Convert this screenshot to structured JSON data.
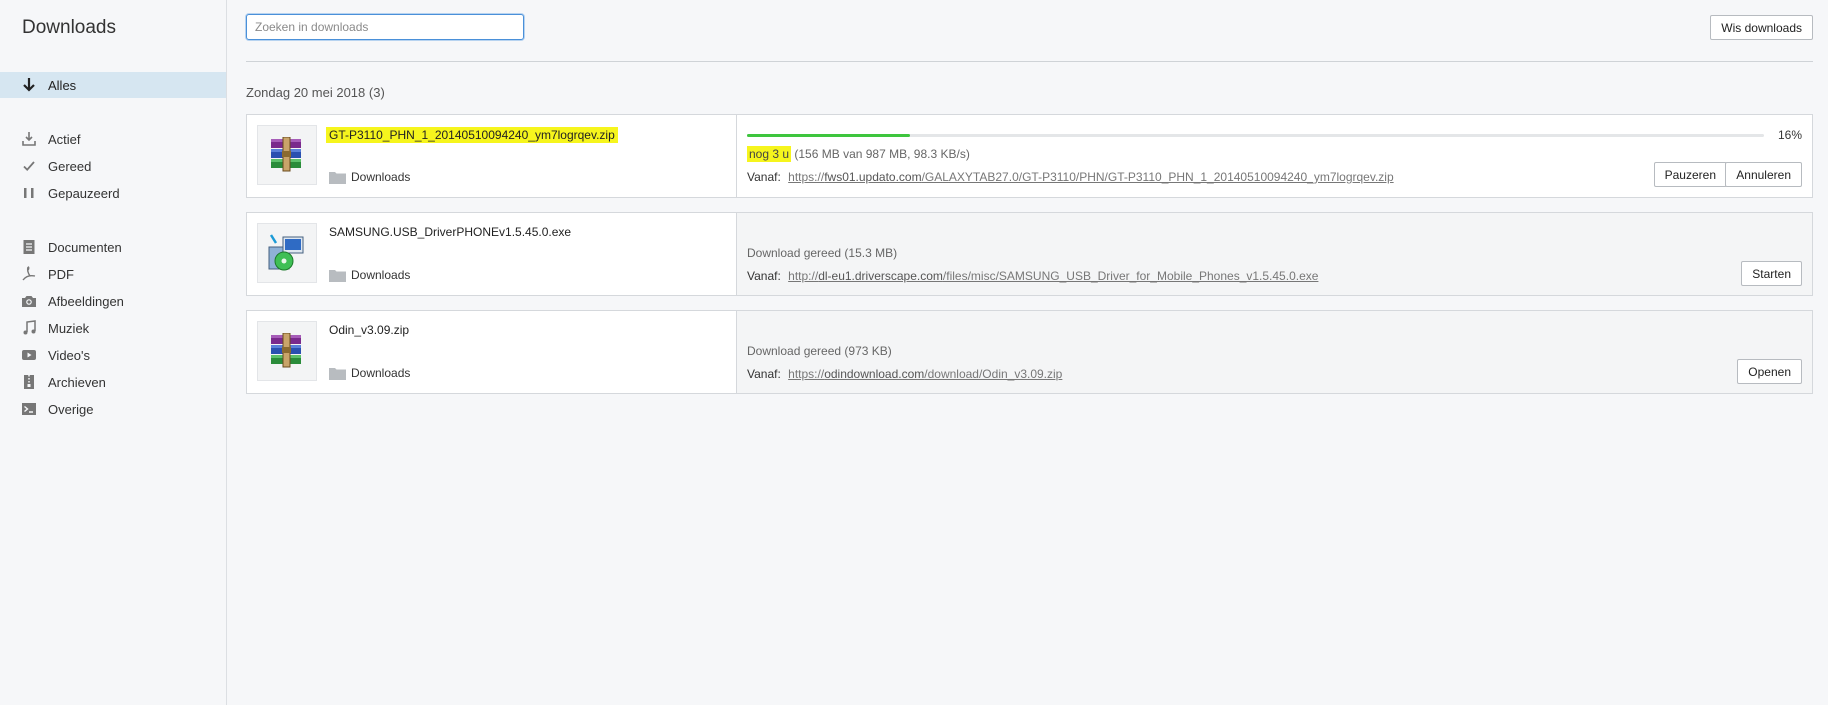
{
  "sidebar": {
    "title": "Downloads",
    "items": [
      {
        "label": "Alles",
        "icon": "arrow-down-icon"
      },
      {
        "label": "Actief",
        "icon": "download-tray-icon"
      },
      {
        "label": "Gereed",
        "icon": "checkmark-icon"
      },
      {
        "label": "Gepauzeerd",
        "icon": "pause-icon"
      },
      {
        "label": "Documenten",
        "icon": "document-icon"
      },
      {
        "label": "PDF",
        "icon": "pdf-icon"
      },
      {
        "label": "Afbeeldingen",
        "icon": "camera-icon"
      },
      {
        "label": "Muziek",
        "icon": "music-note-icon"
      },
      {
        "label": "Video's",
        "icon": "video-icon"
      },
      {
        "label": "Archieven",
        "icon": "archive-icon"
      },
      {
        "label": "Overige",
        "icon": "terminal-icon"
      }
    ]
  },
  "search": {
    "placeholder": "Zoeken in downloads",
    "value": ""
  },
  "toolbar": {
    "clear_label": "Wis downloads"
  },
  "group": {
    "date": "Zondag 20 mei 2018",
    "count": "(3)"
  },
  "downloads": [
    {
      "filename": "GT-P3110_PHN_1_20140510094240_ym7logrqev.zip",
      "folder": "Downloads",
      "progress_label": "16%",
      "progress_value": 0.16,
      "remaining": "nog 3 u",
      "status_detail": "(156 MB van 987 MB, 98.3 KB/s)",
      "source_label": "Vanaf:",
      "url_scheme": "https://",
      "url_host": "fws01.updato.com",
      "url_path": "/GALAXYTAB27.0/GT-P3110/PHN/GT-P3110_PHN_1_20140510094240_ym7logrqev.zip",
      "buttons": [
        "Pauzeren",
        "Annuleren"
      ],
      "icon": "winrar-archive-icon"
    },
    {
      "filename": "SAMSUNG.USB_DriverPHONEv1.5.45.0.exe",
      "folder": "Downloads",
      "status": "Download gereed",
      "size": "(15.3 MB)",
      "source_label": "Vanaf:",
      "url_scheme": "http://",
      "url_host": "dl-eu1.driverscape.com",
      "url_path": "/files/misc/SAMSUNG_USB_Driver_for_Mobile_Phones_v1.5.45.0.exe",
      "buttons": [
        "Starten"
      ],
      "icon": "installer-icon"
    },
    {
      "filename": "Odin_v3.09.zip",
      "folder": "Downloads",
      "status": "Download gereed",
      "size": "(973 KB)",
      "source_label": "Vanaf:",
      "url_scheme": "https://",
      "url_host": "odindownload.com",
      "url_path": "/download/Odin_v3.09.zip",
      "buttons": [
        "Openen"
      ],
      "icon": "winrar-archive-icon"
    }
  ],
  "colors": {
    "progress": "#3ec53e",
    "highlight": "#f6f51d",
    "active_nav": "#d6e6f1"
  }
}
